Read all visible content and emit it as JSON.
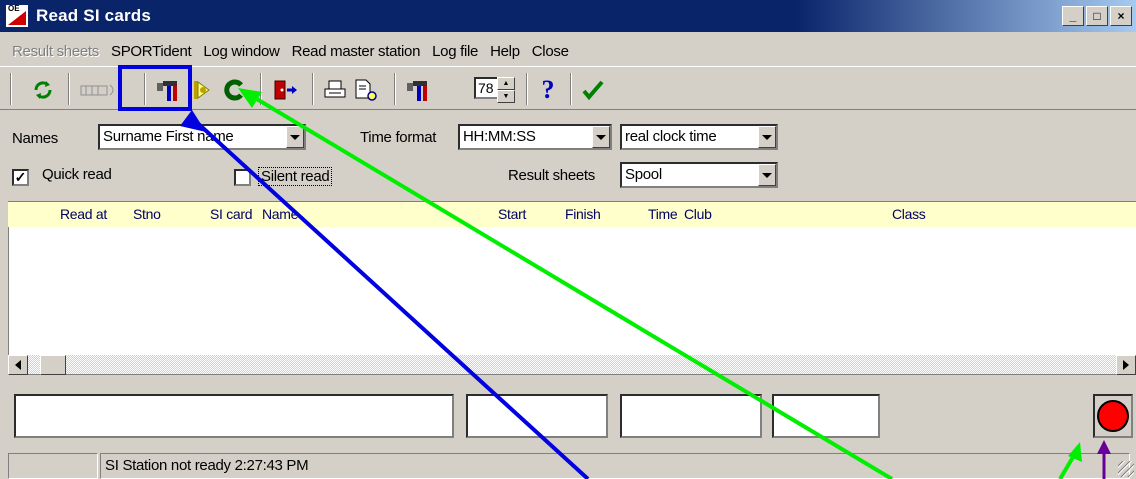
{
  "window": {
    "title": "Read SI cards",
    "app_icon_text": "OE",
    "buttons": [
      "_",
      "□",
      "×"
    ]
  },
  "menu": [
    {
      "label": "Result sheets",
      "disabled": true
    },
    {
      "label": "SPORTident",
      "disabled": false
    },
    {
      "label": "Log window",
      "disabled": false
    },
    {
      "label": "Read master station",
      "disabled": false
    },
    {
      "label": "Log file",
      "disabled": false
    },
    {
      "label": "Help",
      "disabled": false
    },
    {
      "label": "Close",
      "disabled": false
    }
  ],
  "toolbar": {
    "counter_value": "78",
    "icons": [
      "refresh-icon",
      "card-reader-icon",
      "settings-station-icon",
      "key-icon",
      "green-circle-icon",
      "exit-icon",
      "print-icon",
      "print-preview-icon",
      "station-config-icon",
      "help-icon",
      "check-icon"
    ]
  },
  "form": {
    "names_label": "Names",
    "names_value": "Surname First name",
    "time_format_label": "Time format",
    "time_format_value": "HH:MM:SS",
    "clock_value": "real clock time",
    "quick_read_label": "Quick read",
    "quick_read_checked": true,
    "silent_read_label": "Silent read",
    "silent_read_checked": false,
    "result_sheets_label": "Result sheets",
    "result_sheets_value": "Spool"
  },
  "table": {
    "columns": [
      "Read at",
      "Stno",
      "SI card",
      "Name",
      "Start",
      "Finish",
      "Time",
      "Club",
      "Class"
    ],
    "rows": []
  },
  "status": {
    "text": "SI Station not ready  2:27:43 PM"
  },
  "colors": {
    "title_bar": "#0a246a",
    "header_bg": "#ffffcc",
    "indicator": "#ff0000",
    "annotation_blue": "#0000e0",
    "annotation_green": "#00ee00",
    "annotation_purple": "#660099"
  }
}
